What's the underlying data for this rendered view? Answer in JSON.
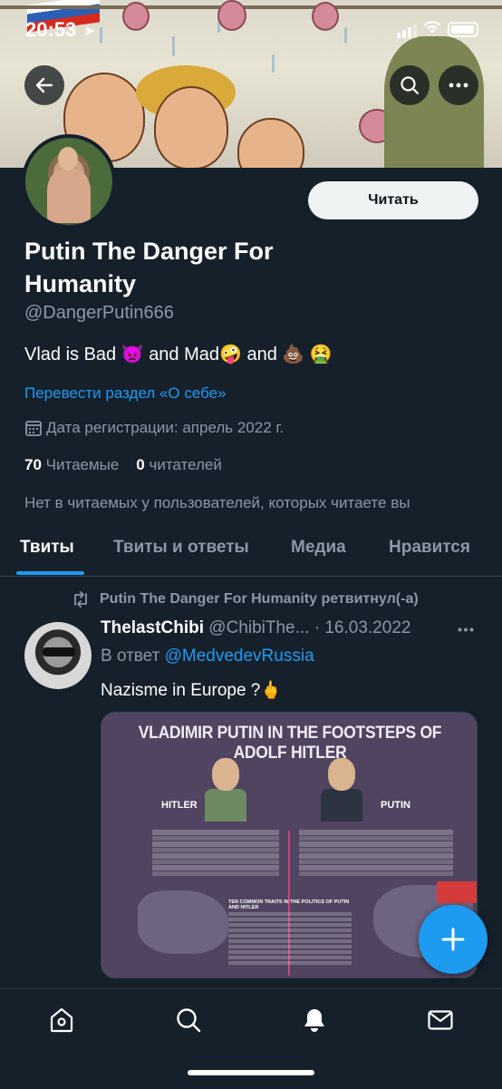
{
  "status_bar": {
    "time": "20:53"
  },
  "profile": {
    "follow_label": "Читать",
    "display_name": "Putin The Danger For Humanity",
    "handle": "@DangerPutin666",
    "bio": "Vlad is Bad 👿 and Mad🤪 and 💩 🤮",
    "translate_bio": "Перевести раздел «О себе»",
    "joined": "Дата регистрации: апрель 2022 г.",
    "following_count": "70",
    "following_label": "Читаемые",
    "followers_count": "0",
    "followers_label": "читателей",
    "not_followed": "Нет в читаемых у пользователей, которых читаете вы"
  },
  "tabs": [
    {
      "label": "Твиты"
    },
    {
      "label": "Твиты и ответы"
    },
    {
      "label": "Медиа"
    },
    {
      "label": "Нравится"
    }
  ],
  "tweet": {
    "retweet_note": "Putin The Danger For Humanity ретвитнул(-а)",
    "author_name": "ThelastChibi",
    "author_handle": "@ChibiThe...",
    "date": "· 16.03.2022",
    "reply_prefix": "В ответ",
    "reply_to": "@MedvedevRussia",
    "text": "Nazisme in Europe ?🖕",
    "image": {
      "title": "VLADIMIR PUTIN IN THE FOOTSTEPS OF ADOLF HITLER",
      "label_left": "HITLER",
      "label_right": "PUTIN",
      "traits_title": "TEN COMMON TRAITS IN THE POLITICS OF PUTIN AND HITLER"
    }
  },
  "icons": {
    "back": "back-arrow-icon",
    "search": "search-icon",
    "more": "more-icon",
    "retweet": "retweet-icon",
    "compose": "compose-plus-icon",
    "home": "home-icon",
    "explore": "search-icon",
    "notifications": "bell-icon",
    "messages": "mail-icon"
  },
  "colors": {
    "accent": "#1d9bf0",
    "background": "#15202b",
    "muted": "#8b98a5"
  }
}
